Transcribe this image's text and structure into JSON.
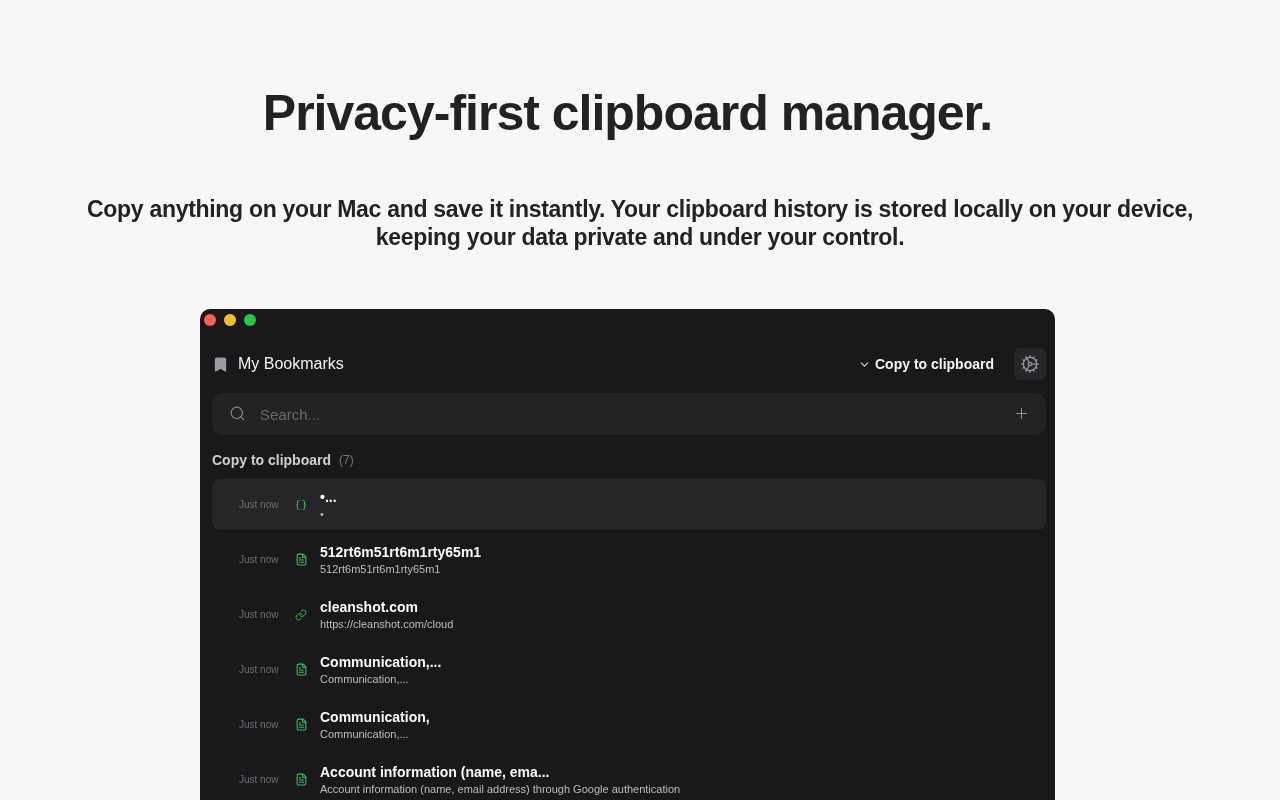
{
  "hero": {
    "title": "Privacy-first clipboard manager.",
    "subtitle": "Copy anything on your Mac and save it instantly. Your clipboard history is stored locally on your device, keeping your data private and under your control."
  },
  "app": {
    "header": {
      "title": "My Bookmarks",
      "action": "Copy to clipboard"
    },
    "search": {
      "placeholder": "Search..."
    },
    "section": {
      "title": "Copy to clipboard",
      "count": "(7)"
    },
    "items": [
      {
        "time": "Just now",
        "kind": "code",
        "title": "•...",
        "subtitle": "•",
        "selected": true
      },
      {
        "time": "Just now",
        "kind": "text",
        "title": "512rt6m51rt6m1rty65m1",
        "subtitle": "512rt6m51rt6m1rty65m1",
        "selected": false
      },
      {
        "time": "Just now",
        "kind": "link",
        "title": "cleanshot.com",
        "subtitle": "https://cleanshot.com/cloud",
        "selected": false
      },
      {
        "time": "Just now",
        "kind": "text",
        "title": "Communication,...",
        "subtitle": "Communication,...",
        "selected": false
      },
      {
        "time": "Just now",
        "kind": "text",
        "title": "Communication,",
        "subtitle": "Communication,...",
        "selected": false
      },
      {
        "time": "Just now",
        "kind": "text",
        "title": "Account information (name, ema...",
        "subtitle": "Account information (name, email address) through Google authentication",
        "selected": false
      }
    ]
  }
}
